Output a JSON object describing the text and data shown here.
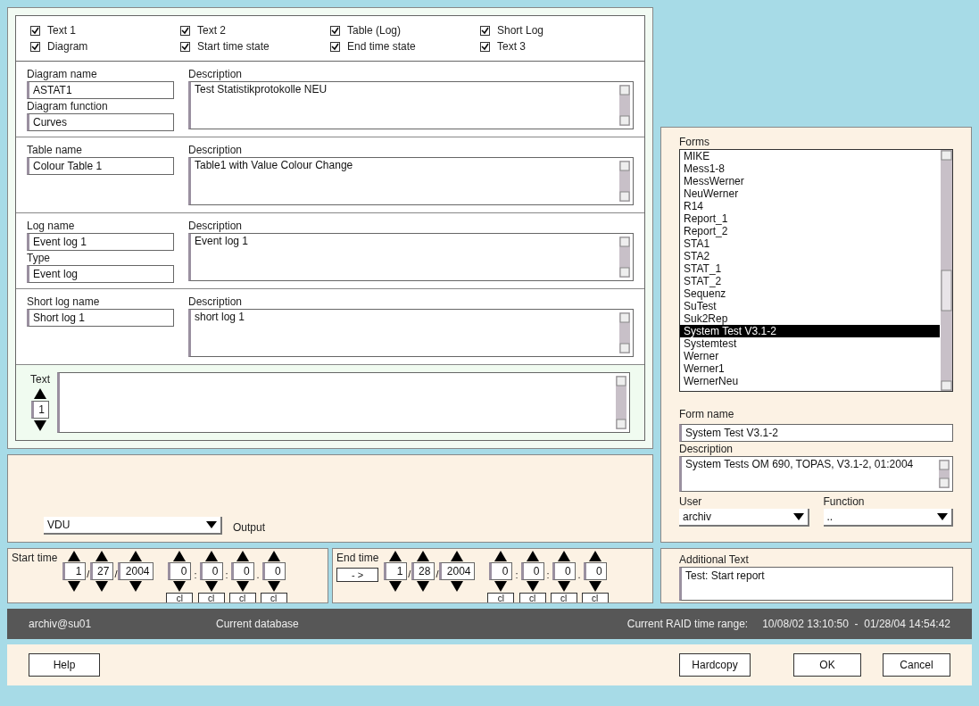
{
  "checkboxes": [
    {
      "label": "Text 1",
      "checked": true
    },
    {
      "label": "Text 2",
      "checked": true
    },
    {
      "label": "Table (Log)",
      "checked": true
    },
    {
      "label": "Short Log",
      "checked": true
    },
    {
      "label": "Diagram",
      "checked": true
    },
    {
      "label": "Start time state",
      "checked": true
    },
    {
      "label": "End time state",
      "checked": true
    },
    {
      "label": "Text 3",
      "checked": true
    }
  ],
  "sections": [
    {
      "name_label": "Diagram name",
      "name_value": "ASTAT1",
      "extra_label": "Diagram function",
      "extra_value": "Curves",
      "description_label": "Description",
      "description_value": "Test Statistikprotokolle NEU"
    },
    {
      "name_label": "Table name",
      "name_value": "Colour Table 1",
      "description_label": "Description",
      "description_value": "Table1 with Value Colour Change"
    },
    {
      "name_label": "Log name",
      "name_value": "Event log 1",
      "extra_label": "Type",
      "extra_value": "Event log",
      "description_label": "Description",
      "description_value": "Event log 1"
    },
    {
      "name_label": "Short log name",
      "name_value": "Short log 1",
      "description_label": "Description",
      "description_value": "short log 1"
    }
  ],
  "text_block": {
    "label": "Text",
    "number": "1"
  },
  "output": {
    "value": "VDU",
    "label": "Output"
  },
  "start_time": {
    "label": "Start time",
    "date": [
      {
        "value": "1",
        "sep": "/"
      },
      {
        "value": "27",
        "sep": "/"
      },
      {
        "value": "2004"
      }
    ],
    "time": [
      {
        "value": "0",
        "sep": ":",
        "clear": "cl"
      },
      {
        "value": "0",
        "sep": ":",
        "clear": "cl"
      },
      {
        "value": "0",
        "sep": ".",
        "clear": "cl"
      },
      {
        "value": "0",
        "clear": "cl"
      }
    ]
  },
  "end_time": {
    "label": "End time",
    "copy_button": "- >",
    "date": [
      {
        "value": "1",
        "sep": "/"
      },
      {
        "value": "28",
        "sep": "/"
      },
      {
        "value": "2004"
      }
    ],
    "time": [
      {
        "value": "0",
        "sep": ":",
        "clear": "cl"
      },
      {
        "value": "0",
        "sep": ":",
        "clear": "cl"
      },
      {
        "value": "0",
        "sep": ".",
        "clear": "cl"
      },
      {
        "value": "0",
        "clear": "cl"
      }
    ]
  },
  "forms": {
    "label": "Forms",
    "items": [
      {
        "label": "MIKE",
        "selected": false
      },
      {
        "label": "Mess1-8",
        "selected": false
      },
      {
        "label": "MessWerner",
        "selected": false
      },
      {
        "label": "NeuWerner",
        "selected": false
      },
      {
        "label": "R14",
        "selected": false
      },
      {
        "label": "Report_1",
        "selected": false
      },
      {
        "label": "Report_2",
        "selected": false
      },
      {
        "label": "STA1",
        "selected": false
      },
      {
        "label": "STA2",
        "selected": false
      },
      {
        "label": "STAT_1",
        "selected": false
      },
      {
        "label": "STAT_2",
        "selected": false
      },
      {
        "label": "Sequenz",
        "selected": false
      },
      {
        "label": "SuTest",
        "selected": false
      },
      {
        "label": "Suk2Rep",
        "selected": false
      },
      {
        "label": "System Test V3.1-2",
        "selected": true
      },
      {
        "label": "Systemtest",
        "selected": false
      },
      {
        "label": "Werner",
        "selected": false
      },
      {
        "label": "Werner1",
        "selected": false
      },
      {
        "label": "WernerNeu",
        "selected": false
      }
    ]
  },
  "form_name": {
    "label": "Form name",
    "value": "System Test V3.1-2"
  },
  "form_description": {
    "label": "Description",
    "value": "System Tests OM 690, TOPAS, V3.1-2, 01:2004"
  },
  "user": {
    "label": "User",
    "value": "archiv"
  },
  "function": {
    "label": "Function",
    "value": ".."
  },
  "additional_text": {
    "label": "Additional Text",
    "value": "Test:  Start report"
  },
  "status_bar": {
    "user": "archiv@su01",
    "database": "Current database",
    "range_label": "Current RAID time range:",
    "range_value": "10/08/02 13:10:50  -  01/28/04 14:54:42"
  },
  "buttons": {
    "help": "Help",
    "hardcopy": "Hardcopy",
    "ok": "OK",
    "cancel": "Cancel"
  }
}
